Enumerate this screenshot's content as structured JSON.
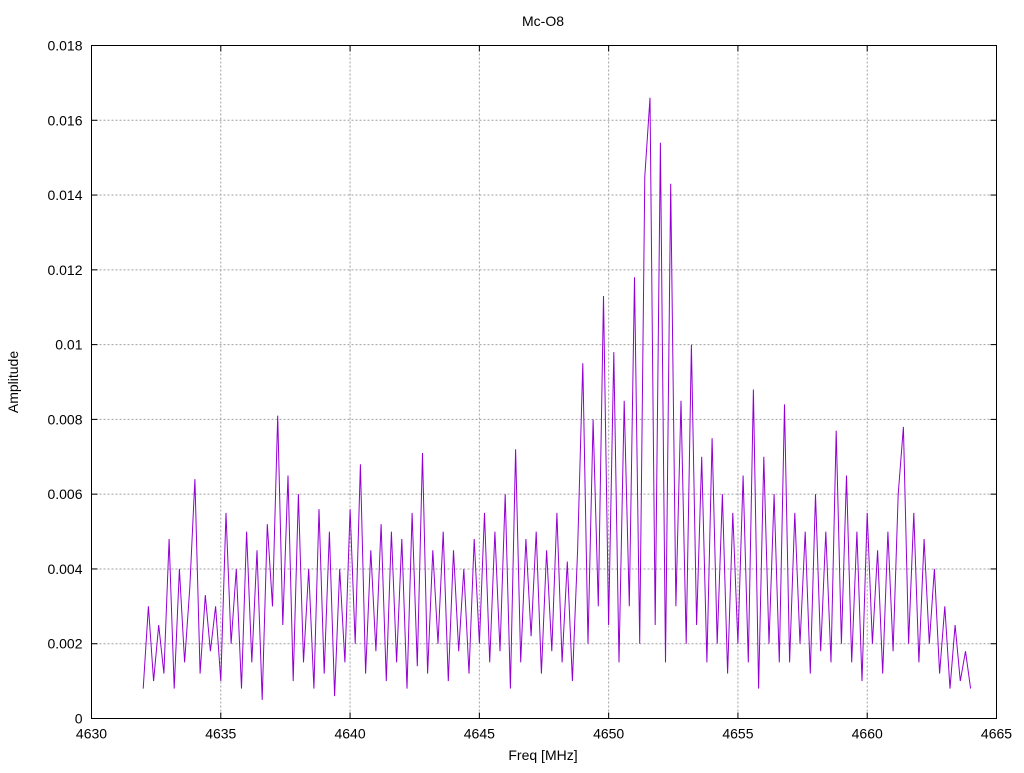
{
  "chart_data": {
    "type": "line",
    "title": "Mc-O8",
    "xlabel": "Freq [MHz]",
    "ylabel": "Amplitude",
    "xlim": [
      4630,
      4665
    ],
    "ylim": [
      0,
      0.018
    ],
    "grid": true,
    "legend": "none",
    "xticks": [
      "4630",
      "4635",
      "4640",
      "4645",
      "4650",
      "4655",
      "4660",
      "4665"
    ],
    "yticks": [
      "0",
      "0.002",
      "0.004",
      "0.006",
      "0.008",
      "0.01",
      "0.012",
      "0.014",
      "0.016",
      "0.018"
    ],
    "series": [
      {
        "name": "Mc-O8",
        "color": "#9400d3",
        "x_start": 4632,
        "x_step": 0.2,
        "values": [
          0.0008,
          0.003,
          0.001,
          0.0025,
          0.0012,
          0.0048,
          0.0008,
          0.004,
          0.0015,
          0.0035,
          0.0064,
          0.0012,
          0.0033,
          0.0018,
          0.003,
          0.001,
          0.0055,
          0.002,
          0.004,
          0.0008,
          0.005,
          0.0015,
          0.0045,
          0.0005,
          0.0052,
          0.003,
          0.0081,
          0.0025,
          0.0065,
          0.001,
          0.006,
          0.0015,
          0.004,
          0.0008,
          0.0056,
          0.0012,
          0.005,
          0.0006,
          0.004,
          0.0015,
          0.0056,
          0.002,
          0.0068,
          0.0012,
          0.0045,
          0.0018,
          0.0052,
          0.001,
          0.005,
          0.0015,
          0.0048,
          0.0008,
          0.0055,
          0.0014,
          0.0071,
          0.0012,
          0.0045,
          0.002,
          0.005,
          0.001,
          0.0045,
          0.0018,
          0.004,
          0.0012,
          0.0048,
          0.002,
          0.0055,
          0.0015,
          0.005,
          0.0018,
          0.006,
          0.0008,
          0.0072,
          0.0015,
          0.0048,
          0.0022,
          0.005,
          0.0012,
          0.0045,
          0.0018,
          0.0055,
          0.0015,
          0.0042,
          0.001,
          0.0045,
          0.0095,
          0.002,
          0.008,
          0.003,
          0.0113,
          0.0025,
          0.0098,
          0.0015,
          0.0085,
          0.003,
          0.0118,
          0.002,
          0.0145,
          0.0166,
          0.0025,
          0.0154,
          0.0015,
          0.0143,
          0.003,
          0.0085,
          0.002,
          0.01,
          0.0025,
          0.007,
          0.0015,
          0.0075,
          0.002,
          0.006,
          0.0012,
          0.0055,
          0.002,
          0.0065,
          0.0015,
          0.0088,
          0.0008,
          0.007,
          0.002,
          0.006,
          0.0015,
          0.0084,
          0.0015,
          0.0055,
          0.002,
          0.005,
          0.0012,
          0.006,
          0.0018,
          0.005,
          0.0015,
          0.0077,
          0.002,
          0.0065,
          0.0015,
          0.005,
          0.001,
          0.0055,
          0.002,
          0.0045,
          0.0012,
          0.005,
          0.0018,
          0.006,
          0.0078,
          0.002,
          0.0055,
          0.0015,
          0.0048,
          0.002,
          0.004,
          0.0012,
          0.003,
          0.0008,
          0.0025,
          0.001,
          0.0018,
          0.0008
        ]
      }
    ]
  }
}
